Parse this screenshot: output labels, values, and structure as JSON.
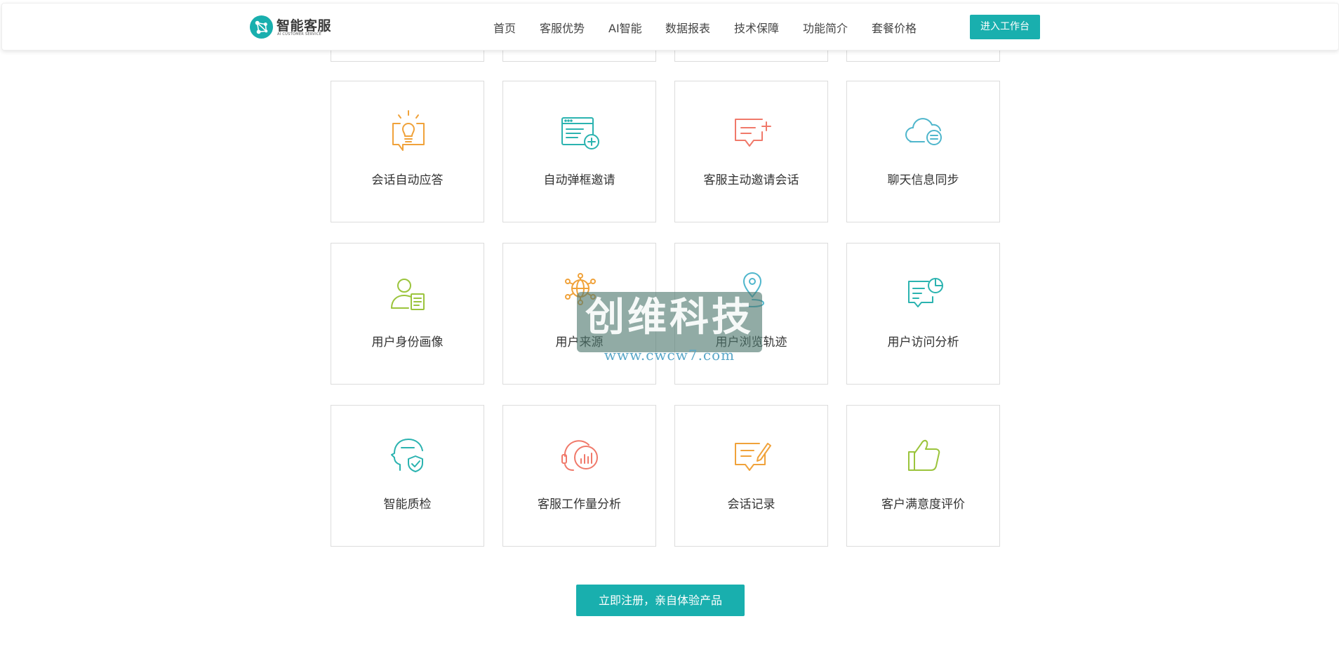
{
  "header": {
    "logo": {
      "name": "智能客服",
      "subtitle": "AI CUSTOMER SERVICE"
    },
    "nav": [
      {
        "label": "首页"
      },
      {
        "label": "客服优势"
      },
      {
        "label": "AI智能"
      },
      {
        "label": "数据报表"
      },
      {
        "label": "技术保障"
      },
      {
        "label": "功能简介"
      },
      {
        "label": "套餐价格"
      }
    ],
    "workbench_button": "进入工作台"
  },
  "features": [
    {
      "label": "会话自动应答",
      "icon": "lightbulb-chat-icon",
      "color": "#f0a23a"
    },
    {
      "label": "自动弹框邀请",
      "icon": "popup-window-add-icon",
      "color": "#2bb3b0"
    },
    {
      "label": "客服主动邀请会话",
      "icon": "chat-add-icon",
      "color": "#f0796a"
    },
    {
      "label": "聊天信息同步",
      "icon": "cloud-sync-icon",
      "color": "#4fb6cc"
    },
    {
      "label": "用户身份画像",
      "icon": "user-profile-icon",
      "color": "#9bc43c"
    },
    {
      "label": "用户来源",
      "icon": "globe-network-icon",
      "color": "#f0a23a"
    },
    {
      "label": "用户浏览轨迹",
      "icon": "location-pin-icon",
      "color": "#4fb6cc"
    },
    {
      "label": "用户访问分析",
      "icon": "document-pie-chart-icon",
      "color": "#2bb3b0"
    },
    {
      "label": "智能质检",
      "icon": "head-shield-icon",
      "color": "#2bb3b0"
    },
    {
      "label": "客服工作量分析",
      "icon": "headset-bar-chart-icon",
      "color": "#f0796a"
    },
    {
      "label": "会话记录",
      "icon": "chat-edit-icon",
      "color": "#f0a23a"
    },
    {
      "label": "客户满意度评价",
      "icon": "thumbs-up-icon",
      "color": "#9bc43c"
    }
  ],
  "cta_button": "立即注册，亲自体验产品",
  "watermark": {
    "title": "创维科技",
    "url": "www.cwcw7.com"
  },
  "colors": {
    "brand": "#19afae",
    "border": "#dcdcdc",
    "text": "#333333"
  }
}
